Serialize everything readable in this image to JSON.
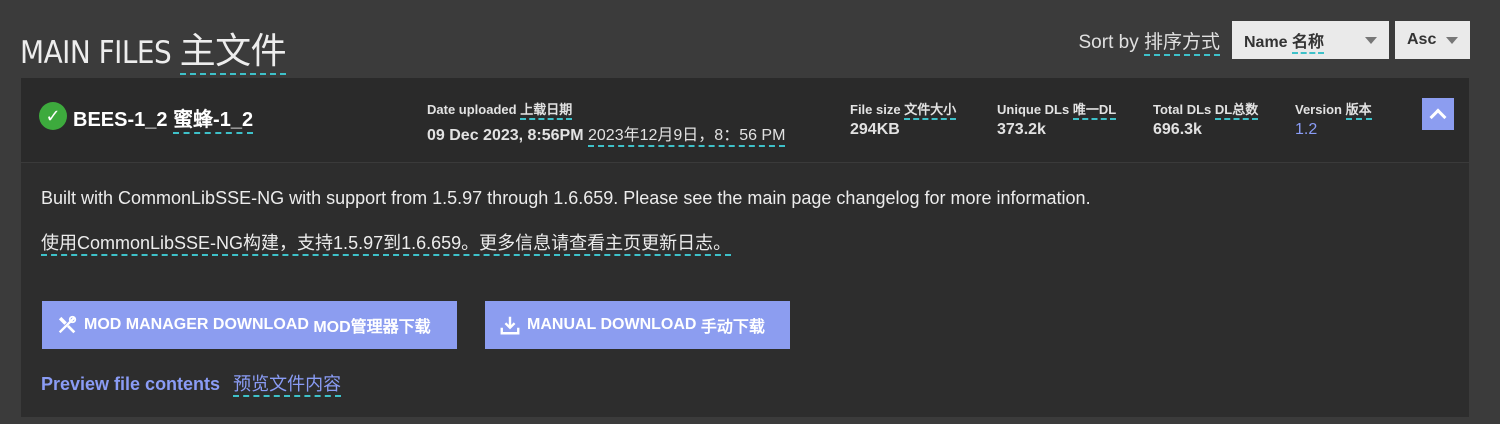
{
  "header": {
    "title_en": "MAIN FILES",
    "title_zh": "主文件",
    "sort_label_en": "Sort by",
    "sort_label_zh": "排序方式",
    "sort_field_en": "Name",
    "sort_field_zh": "名称",
    "sort_direction": "Asc"
  },
  "file": {
    "name": "BEES-1_2",
    "name_zh": "蜜蜂-1_2",
    "date_label_en": "Date uploaded",
    "date_label_zh": "上载日期",
    "date_value_en": "09 Dec 2023, 8:56PM",
    "date_value_zh": "2023年12月9日，8：56 PM",
    "size_label_en": "File size",
    "size_label_zh": "文件大小",
    "size_value": "294KB",
    "unique_label_en": "Unique DLs",
    "unique_label_zh": "唯一DL",
    "unique_value": "373.2k",
    "total_label_en": "Total DLs",
    "total_label_zh": "DL总数",
    "total_value": "696.3k",
    "version_label_en": "Version",
    "version_label_zh": "版本",
    "version_value": "1.2",
    "description_en": "Built with CommonLibSSE-NG with support from 1.5.97 through 1.6.659. Please see the main page changelog for more information.",
    "description_zh": "使用CommonLibSSE-NG构建，支持1.5.97到1.6.659。更多信息请查看主页更新日志。"
  },
  "actions": {
    "mod_manager_en": "MOD MANAGER DOWNLOAD",
    "mod_manager_zh": "MOD管理器下载",
    "manual_en": "MANUAL DOWNLOAD",
    "manual_zh": "手动下载",
    "preview_en": "Preview file contents",
    "preview_zh": "预览文件内容"
  },
  "colors": {
    "background": "#3b3b3b",
    "card": "#2d2d2d",
    "accent": "#8c9df0",
    "success": "#3daa3d",
    "translation_underline": "#3ec1c9"
  },
  "icons": [
    "check-circle-icon",
    "chevron-up-icon",
    "tools-icon",
    "download-icon",
    "caret-down-icon"
  ]
}
